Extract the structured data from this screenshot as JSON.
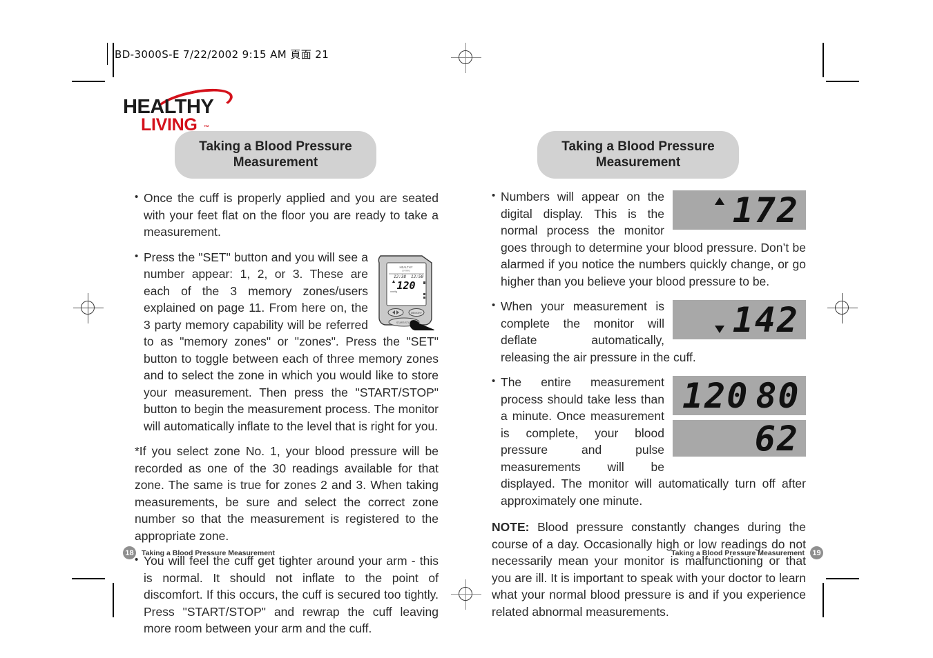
{
  "scan": {
    "header_text": "BD-3000S-E  7/22/2002  9:15 AM  頁面 21"
  },
  "logo": {
    "line1": "HEALTHY",
    "line2": "LIVING",
    "tm": "™",
    "swoosh_color": "#d4111b",
    "line2_color": "#d4111b",
    "line1_color": "#1c1c1c"
  },
  "left_page": {
    "title": "Taking a Blood Pressure Measurement",
    "title_line1": "Taking a Blood Pressure",
    "title_line2": "Measurement",
    "bullets": [
      "Once the cuff is properly applied and you are seated with your feet flat on the floor you are ready to take a measurement.",
      "Press the \"SET\" button and you will see a number appear: 1, 2, or 3. These are each of the 3 memory zones/users explained on page 11. From here on, the 3 party memory capability will be referred to as \"memory zones\" or \"zones\". Press the \"SET\" button to toggle between each of three memory zones and to select the zone in which you would like to store your measurement. Then press the \"START/STOP\" button to begin the measurement process. The monitor will automatically inflate to the level that is right for you.",
      "You will feel the cuff get tighter around your arm - this is normal. It should not inflate to the point of discomfort. If this occurs, the cuff is secured too tightly. Press \"START/STOP\" and rewrap the cuff leaving more room between your arm and the cuff."
    ],
    "footnote": "*If you select zone No. 1, your blood pressure will be recorded as one of the 30 readings available for that zone. The same is true for zones 2 and 3. When taking measurements, be sure and select the correct zone number so that the measurement is registered to the appropriate zone.",
    "device_display_value": "120",
    "footer_text": "Taking a Blood Pressure Measurement",
    "page_number": "18"
  },
  "right_page": {
    "title_line1": "Taking a Blood Pressure",
    "title_line2": "Measurement",
    "bullets": [
      "Numbers will appear on the digital display. This is the normal process the monitor goes through to determine your blood pressure. Don’t be alarmed if you notice the numbers quickly change, or go higher than you believe your blood pressure to be.",
      "When your measurement is complete the monitor will deflate automatically, releasing the air pressure in the cuff.",
      "The entire measurement process should take less than a minute. Once measurement is complete, your blood pressure and pulse measurements will be displayed. The monitor will automatically turn off after approximately one minute."
    ],
    "lcd_panels": [
      {
        "name": "inflating-reading",
        "arrow": "up",
        "values": [
          "172"
        ]
      },
      {
        "name": "deflating-reading",
        "arrow": "down",
        "values": [
          "142"
        ]
      },
      {
        "name": "systolic-diastolic-reading",
        "arrow": "none",
        "values": [
          "120",
          "80"
        ]
      },
      {
        "name": "pulse-reading",
        "arrow": "none",
        "values": [
          "62"
        ]
      }
    ],
    "note_label": "NOTE:",
    "note_text": " Blood pressure constantly changes during the course of a day. Occasionally high or low readings do not necessarily mean your monitor is malfunctioning or that you are ill. It is important to speak with your doctor to learn what your normal blood pressure is and if you experience related abnormal measurements.",
    "footer_text": "Taking a Blood Pressure Measurement",
    "page_number": "19"
  },
  "colors": {
    "badge_gray": "#d2d2d2",
    "lcd_gray": "#a8a8a8",
    "page_badge_gray": "#8f8f8f",
    "brand_red": "#d4111b"
  }
}
